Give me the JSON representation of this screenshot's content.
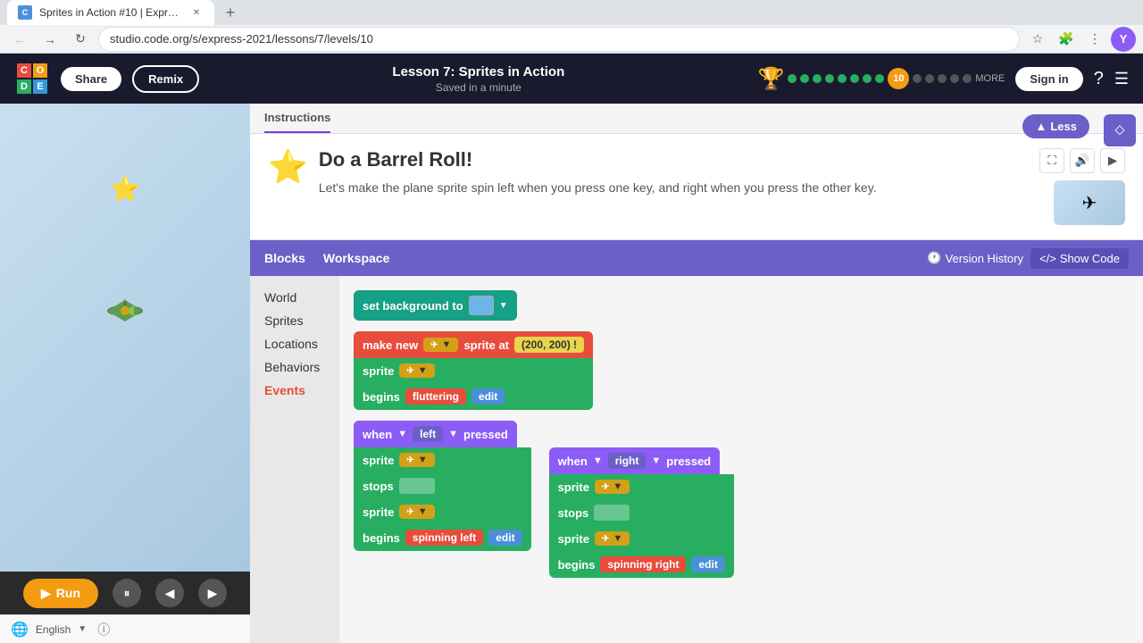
{
  "browser": {
    "tab_title": "Sprites in Action #10 | Express C...",
    "url": "studio.code.org/s/express-2021/lessons/7/levels/10",
    "profile_letter": "Y"
  },
  "header": {
    "logo": {
      "c": "C",
      "o": "O",
      "d": "D",
      "e": "E"
    },
    "share_label": "Share",
    "remix_label": "Remix",
    "lesson_title": "Lesson 7: Sprites in Action",
    "saved_status": "Saved in a minute",
    "current_level": "10",
    "sign_in_label": "Sign in",
    "more_label": "MORE"
  },
  "workspace": {
    "blocks_label": "Blocks",
    "workspace_label": "Workspace",
    "version_history_label": "Version History",
    "show_code_label": "Show Code"
  },
  "blocks": {
    "categories": [
      "World",
      "Sprites",
      "Locations",
      "Behaviors",
      "Events"
    ]
  },
  "instructions": {
    "tab_label": "Instructions",
    "title": "Do a Barrel Roll!",
    "description": "Let's make the plane sprite spin left when you press one key, and right when you press the other key.",
    "less_label": "Less"
  },
  "controls": {
    "run_label": "Run",
    "pause_icon": "⏸",
    "back_icon": "◀",
    "forward_icon": "▶"
  },
  "footer": {
    "language": "English"
  }
}
